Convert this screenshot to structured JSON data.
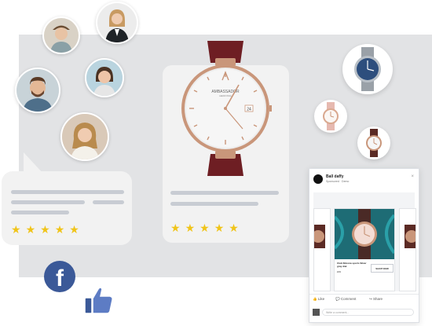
{
  "watch_brand": {
    "name": "AMBASSADOR",
    "sub": "HEIROSSA",
    "date": "24"
  },
  "post": {
    "page_name": "Ball daffy",
    "page_sub": "Sponsored · Demo",
    "close": "×",
    "slide_title": "Club Shirena sports Silver gray dial",
    "slide_price": "£99",
    "shop_now": "SHOP NOW",
    "actions": {
      "like": "Like",
      "comment": "Comment",
      "share": "Share"
    },
    "comment_placeholder": "Write a comment..."
  },
  "icons": {
    "facebook": "f",
    "like": "thumbs-up-icon"
  },
  "stars": {
    "value": 5,
    "max": 5,
    "glyph": "★"
  },
  "colors": {
    "backdrop": "#e2e3e5",
    "card": "#f2f2f2",
    "bar": "#c8ccd3",
    "star": "#f0c419",
    "facebook_blue": "#3b5998",
    "strap": "#6e1e23",
    "rose_gold": "#c9967a"
  }
}
